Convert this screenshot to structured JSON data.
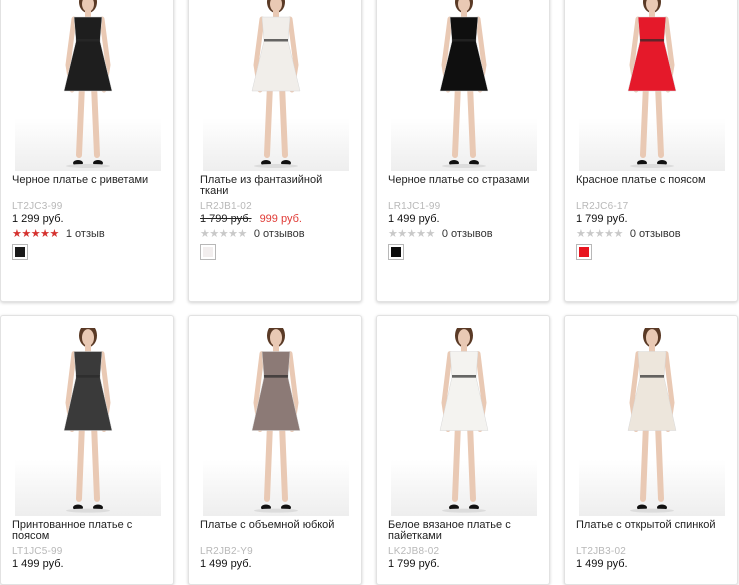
{
  "colors": {
    "price_sale": "#e03a35",
    "star_filled": "#d5322f",
    "star_empty": "#c9c9c9",
    "sku_text": "#b8b8b8"
  },
  "products": [
    {
      "name": "Черное платье с риветами",
      "sku": "LT2JC3-99",
      "price": "1 299 руб.",
      "rating_filled": 5,
      "reviews": "1 отзыв",
      "swatch_color": "#1a1a1a",
      "dress_color": "#1e1e1e"
    },
    {
      "name": "Платье из фантазийной ткани",
      "sku": "LR2JB1-02",
      "price_old": "1 799 руб.",
      "price": "999 руб.",
      "rating_filled": 0,
      "reviews": "0 отзывов",
      "swatch_color": "#f2eeee",
      "dress_color": "#f1eeea"
    },
    {
      "name": "Черное платье со стразами",
      "sku": "LR1JC1-99",
      "price": "1 499 руб.",
      "rating_filled": 0,
      "reviews": "0 отзывов",
      "swatch_color": "#0c0c0c",
      "dress_color": "#0f0f0f"
    },
    {
      "name": "Красное платье с поясом",
      "sku": "LR2JC6-17",
      "price": "1 799 руб.",
      "rating_filled": 0,
      "reviews": "0 отзывов",
      "swatch_color": "#e8141e",
      "dress_color": "#e5192a"
    },
    {
      "name": "Принтованное платье с поясом",
      "sku": "LT1JC5-99",
      "price": "1 499 руб.",
      "dress_color": "#3a3a3a"
    },
    {
      "name": "Платье с объемной юбкой",
      "sku": "LR2JB2-Y9",
      "price": "1 499 руб.",
      "dress_color": "#8c7a76"
    },
    {
      "name": "Белое вязаное платье с пайетками",
      "sku": "LK2JB8-02",
      "price": "1 799 руб.",
      "dress_color": "#f4f3f0"
    },
    {
      "name": "Платье с открытой спинкой",
      "sku": "LT2JB3-02",
      "price": "1 499 руб.",
      "dress_color": "#ede6dc"
    }
  ]
}
